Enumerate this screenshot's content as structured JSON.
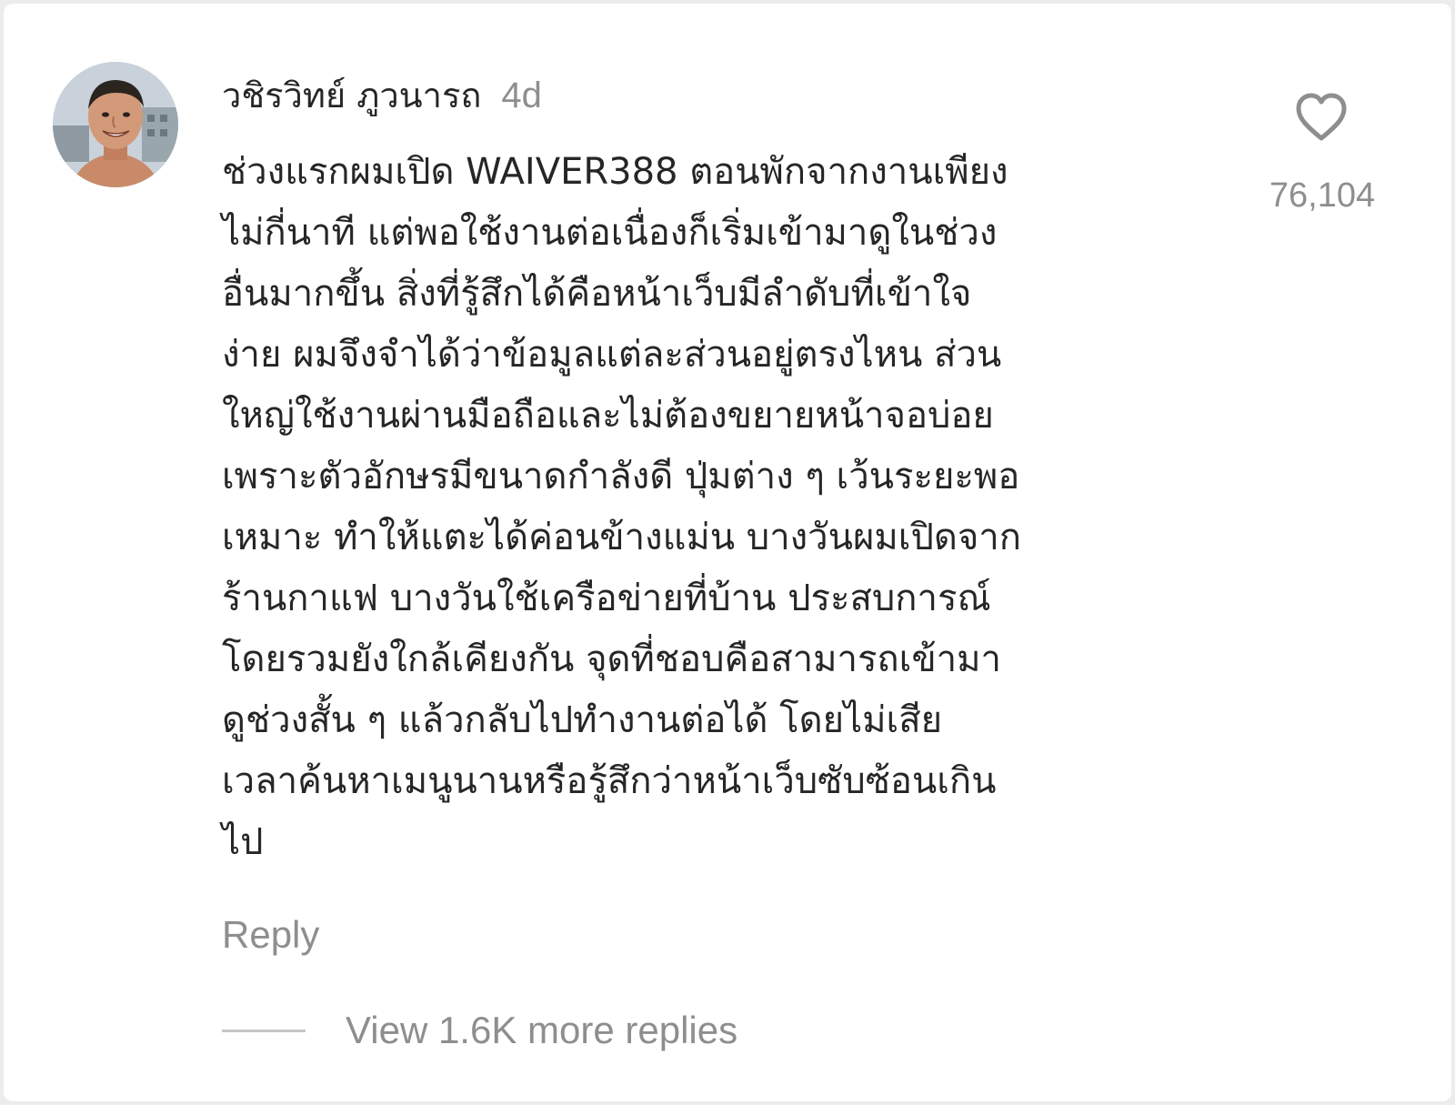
{
  "comment": {
    "username": "วชิรวิทย์ ภูวนารถ",
    "time": "4d",
    "text": "ช่วงแรกผมเปิด WAIVER388 ตอนพักจากงานเพียง\nไม่กี่นาที แต่พอใช้งานต่อเนื่องก็เริ่มเข้ามาดูในช่วง\nอื่นมากขึ้น สิ่งที่รู้สึกได้คือหน้าเว็บมีลำดับที่เข้าใจ\nง่าย ผมจึงจำได้ว่าข้อมูลแต่ละส่วนอยู่ตรงไหน ส่วน\nใหญ่ใช้งานผ่านมือถือและไม่ต้องขยายหน้าจอบ่อย\nเพราะตัวอักษรมีขนาดกำลังดี ปุ่มต่าง ๆ เว้นระยะพอ\nเหมาะ ทำให้แตะได้ค่อนข้างแม่น บางวันผมเปิดจาก\nร้านกาแฟ บางวันใช้เครือข่ายที่บ้าน ประสบการณ์\nโดยรวมยังใกล้เคียงกัน จุดที่ชอบคือสามารถเข้ามา\nดูช่วงสั้น ๆ แล้วกลับไปทำงานต่อได้ โดยไม่เสีย\nเวลาค้นหาเมนูนานหรือรู้สึกว่าหน้าเว็บซับซ้อนเกิน\nไป",
    "like_count": "76,104",
    "like_icon": "heart-outline-icon",
    "reply_label": "Reply",
    "view_replies_label": "View 1.6K more replies"
  },
  "colors": {
    "text_primary": "#262626",
    "text_secondary": "#8e8e8e",
    "divider": "#c7c7c7",
    "background": "#ffffff"
  }
}
